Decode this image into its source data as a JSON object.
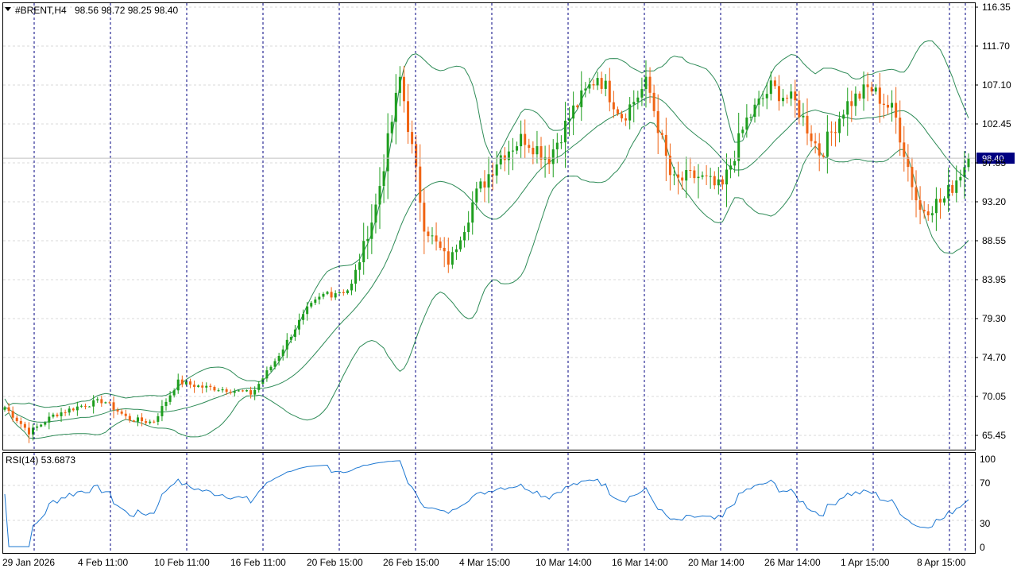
{
  "header": {
    "symbol": "#BRENT,H4",
    "ohlc": "98.56 98.72 98.25 98.40"
  },
  "price_axis": {
    "labels": [
      "116.35",
      "111.70",
      "107.10",
      "102.45",
      "97.85",
      "93.20",
      "88.55",
      "83.95",
      "79.30",
      "74.70",
      "70.05",
      "65.45"
    ],
    "current_price_label": "98.40"
  },
  "rsi_panel": {
    "title": "RSI(14) 53.6873",
    "labels": [
      "100",
      "70",
      "30",
      "0"
    ]
  },
  "time_axis": {
    "labels": [
      "29 Jan 2026",
      "4 Feb 11:00",
      "10 Feb 11:00",
      "16 Feb 11:00",
      "20 Feb 15:00",
      "26 Feb 15:00",
      "4 Mar 15:00",
      "10 Mar 14:00",
      "16 Mar 14:00",
      "20 Mar 14:00",
      "26 Mar 14:00",
      "1 Apr 15:00",
      "8 Apr 15:00"
    ]
  },
  "colors": {
    "bull": "#1e9e1e",
    "bear": "#f06414",
    "bands": "#2e8b57",
    "rsi": "#1e78d2",
    "grid": "#d8d8d8",
    "separator": "#000080",
    "text": "#000000"
  },
  "chart_data": {
    "type": "candlestick",
    "price_range": [
      63.5,
      117.2
    ],
    "rsi_range": [
      0,
      100
    ],
    "rsi_levels": [
      30,
      70
    ],
    "indicators": [
      "Bollinger Bands",
      "RSI(14)"
    ],
    "last": 98.4,
    "rsi_last": 53.6873,
    "anchors": [
      {
        "date": "29 Jan 2026",
        "price": 68.8
      },
      {
        "date": "30 Jan 2026",
        "price": 65.8
      },
      {
        "date": "4 Feb 11:00",
        "price": 67.9
      },
      {
        "date": "10 Feb 11:00",
        "price": 68.9
      },
      {
        "date": "12 Feb",
        "price": 69.6
      },
      {
        "date": "16 Feb 11:00",
        "price": 67.4
      },
      {
        "date": "17 Feb",
        "price": 67.0
      },
      {
        "date": "18 Feb",
        "price": 71.8
      },
      {
        "date": "20 Feb 15:00",
        "price": 71.2
      },
      {
        "date": "24 Feb",
        "price": 70.9
      },
      {
        "date": "25 Feb",
        "price": 70.4
      },
      {
        "date": "26 Feb 15:00",
        "price": 74.6
      },
      {
        "date": "27 Feb",
        "price": 79.4
      },
      {
        "date": "2 Mar",
        "price": 82.4
      },
      {
        "date": "3 Mar",
        "price": 82.9
      },
      {
        "date": "4 Mar 15:00",
        "price": 92.5
      },
      {
        "date": "5 Mar",
        "price": 108.0
      },
      {
        "date": "6 Mar",
        "price": 90.2
      },
      {
        "date": "9 Mar",
        "price": 85.9
      },
      {
        "date": "10 Mar 14:00",
        "price": 93.6
      },
      {
        "date": "11 Mar",
        "price": 98.6
      },
      {
        "date": "13 Mar",
        "price": 100.9
      },
      {
        "date": "16 Mar 14:00",
        "price": 98.4
      },
      {
        "date": "17 Mar",
        "price": 104.1
      },
      {
        "date": "18 Mar",
        "price": 108.3
      },
      {
        "date": "19 Mar",
        "price": 103.4
      },
      {
        "date": "20 Mar 14:00",
        "price": 107.4
      },
      {
        "date": "23 Mar",
        "price": 95.5
      },
      {
        "date": "24 Mar",
        "price": 96.3
      },
      {
        "date": "25 Mar",
        "price": 94.6
      },
      {
        "date": "26 Mar 14:00",
        "price": 102.8
      },
      {
        "date": "27 Mar",
        "price": 106.8
      },
      {
        "date": "30 Mar",
        "price": 104.9
      },
      {
        "date": "31 Mar",
        "price": 98.9
      },
      {
        "date": "1 Apr 15:00",
        "price": 104.6
      },
      {
        "date": "2 Apr",
        "price": 106.8
      },
      {
        "date": "6 Apr",
        "price": 103.8
      },
      {
        "date": "7 Apr",
        "price": 92.2
      },
      {
        "date": "8 Apr 15:00",
        "price": 93.4
      },
      {
        "date": "9 Apr",
        "price": 98.4
      }
    ]
  }
}
